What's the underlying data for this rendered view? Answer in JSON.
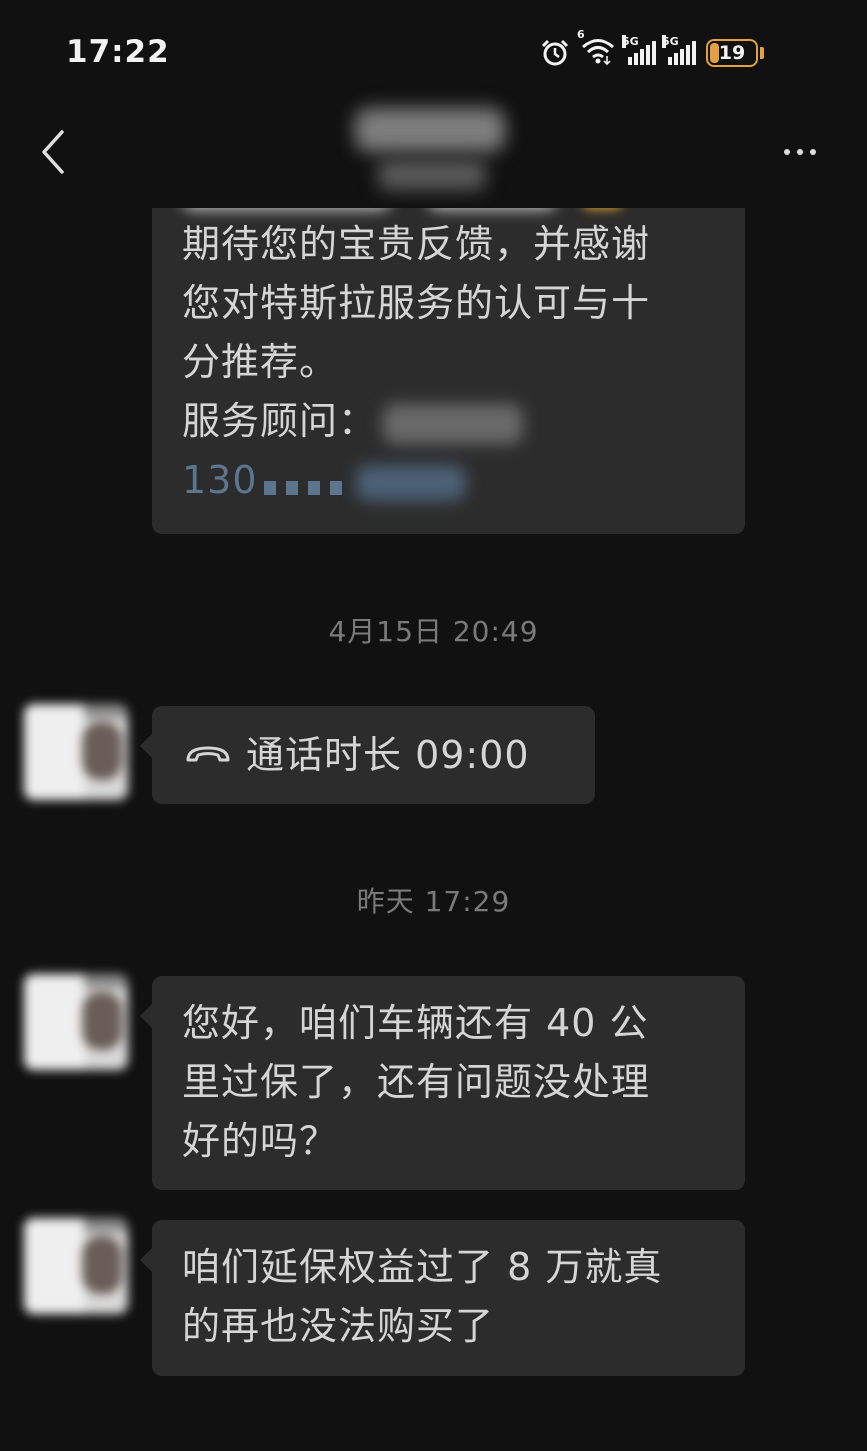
{
  "status_bar": {
    "time": "17:22",
    "icons": [
      "alarm-icon",
      "wifi-icon",
      "signal-5g-icon",
      "signal-5g-icon",
      "battery-icon"
    ],
    "wifi_tag": "6",
    "sim1_tag": "5G",
    "sim2_tag": "5G",
    "battery_level": "19",
    "battery_color": "#e2a040"
  },
  "header": {
    "back_icon": "chevron-left-icon",
    "more_icon": "more-dots-icon"
  },
  "messages": [
    {
      "type": "text",
      "lines": [
        "期待您的宝贵反馈，并感谢",
        "您对特斯拉服务的认可与十",
        "分推荐。"
      ],
      "advisor_label": "服务顾问：",
      "phone_prefix": "130"
    },
    {
      "type": "timestamp",
      "text": "4月15日 20:49"
    },
    {
      "type": "call",
      "icon": "phone-hangup-icon",
      "label": "通话时长 09:00"
    },
    {
      "type": "timestamp",
      "text": "昨天 17:29"
    },
    {
      "type": "text",
      "lines": [
        "您好，咱们车辆还有 40 公",
        "里过保了，还有问题没处理",
        "好的吗？"
      ]
    },
    {
      "type": "text",
      "lines": [
        "咱们延保权益过了 8 万就真",
        "的再也没法购买了"
      ]
    }
  ],
  "colors": {
    "background": "#111111",
    "bubble": "#2c2c2c",
    "text": "#d5d5d5",
    "timestamp": "#7a7a7a",
    "link": "#5d7690"
  }
}
